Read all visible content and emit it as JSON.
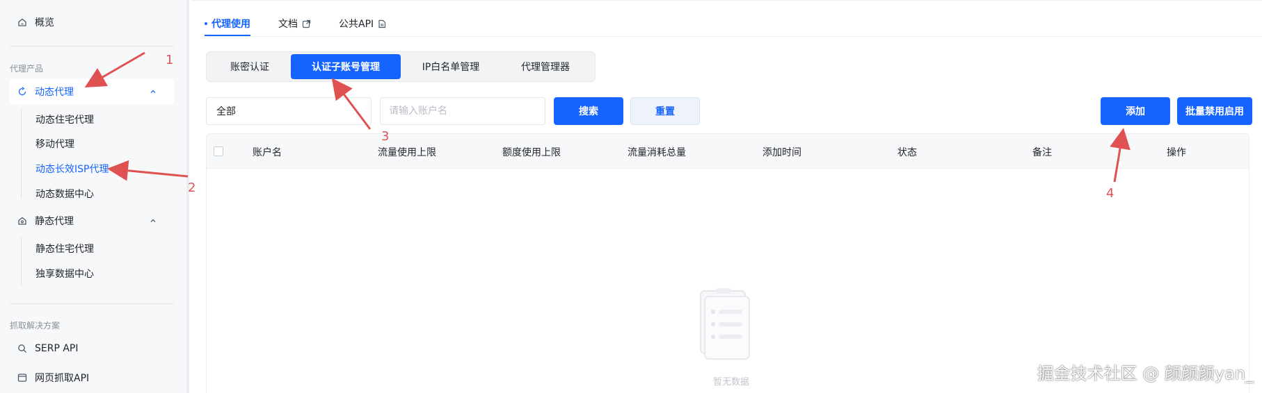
{
  "sidebar": {
    "overview": "概览",
    "section_products": "代理产品",
    "dynamic_proxy": "动态代理",
    "dynamic_children": [
      "动态住宅代理",
      "移动代理",
      "动态长效ISP代理",
      "动态数据中心"
    ],
    "static_proxy": "静态代理",
    "static_children": [
      "静态住宅代理",
      "独享数据中心"
    ],
    "section_scrape": "抓取解决方案",
    "serp_api": "SERP API",
    "web_scrape_api": "网页抓取API"
  },
  "main": {
    "tabs": [
      {
        "label": "代理使用"
      },
      {
        "label": "文档"
      },
      {
        "label": "公共API"
      }
    ],
    "segments": [
      "账密认证",
      "认证子账号管理",
      "IP白名单管理",
      "代理管理器"
    ],
    "filter": {
      "select_value": "全部",
      "account_placeholder": "请输入账户名",
      "search_label": "搜索",
      "reset_label": "重置"
    },
    "actions": {
      "add_label": "添加",
      "batch_label": "批量禁用启用"
    },
    "table": {
      "columns": [
        "账户名",
        "流量使用上限",
        "额度使用上限",
        "流量消耗总量",
        "添加时间",
        "状态",
        "备注",
        "操作"
      ],
      "empty_text": "暂无数据"
    }
  },
  "annotations": [
    "1",
    "2",
    "3",
    "4"
  ],
  "watermark": "掘金技术社区 @ 颜颜颜yan_",
  "colors": {
    "accent": "#1664ff",
    "sidebar_bg": "#f7f8fa",
    "annotation": "#e05252"
  }
}
